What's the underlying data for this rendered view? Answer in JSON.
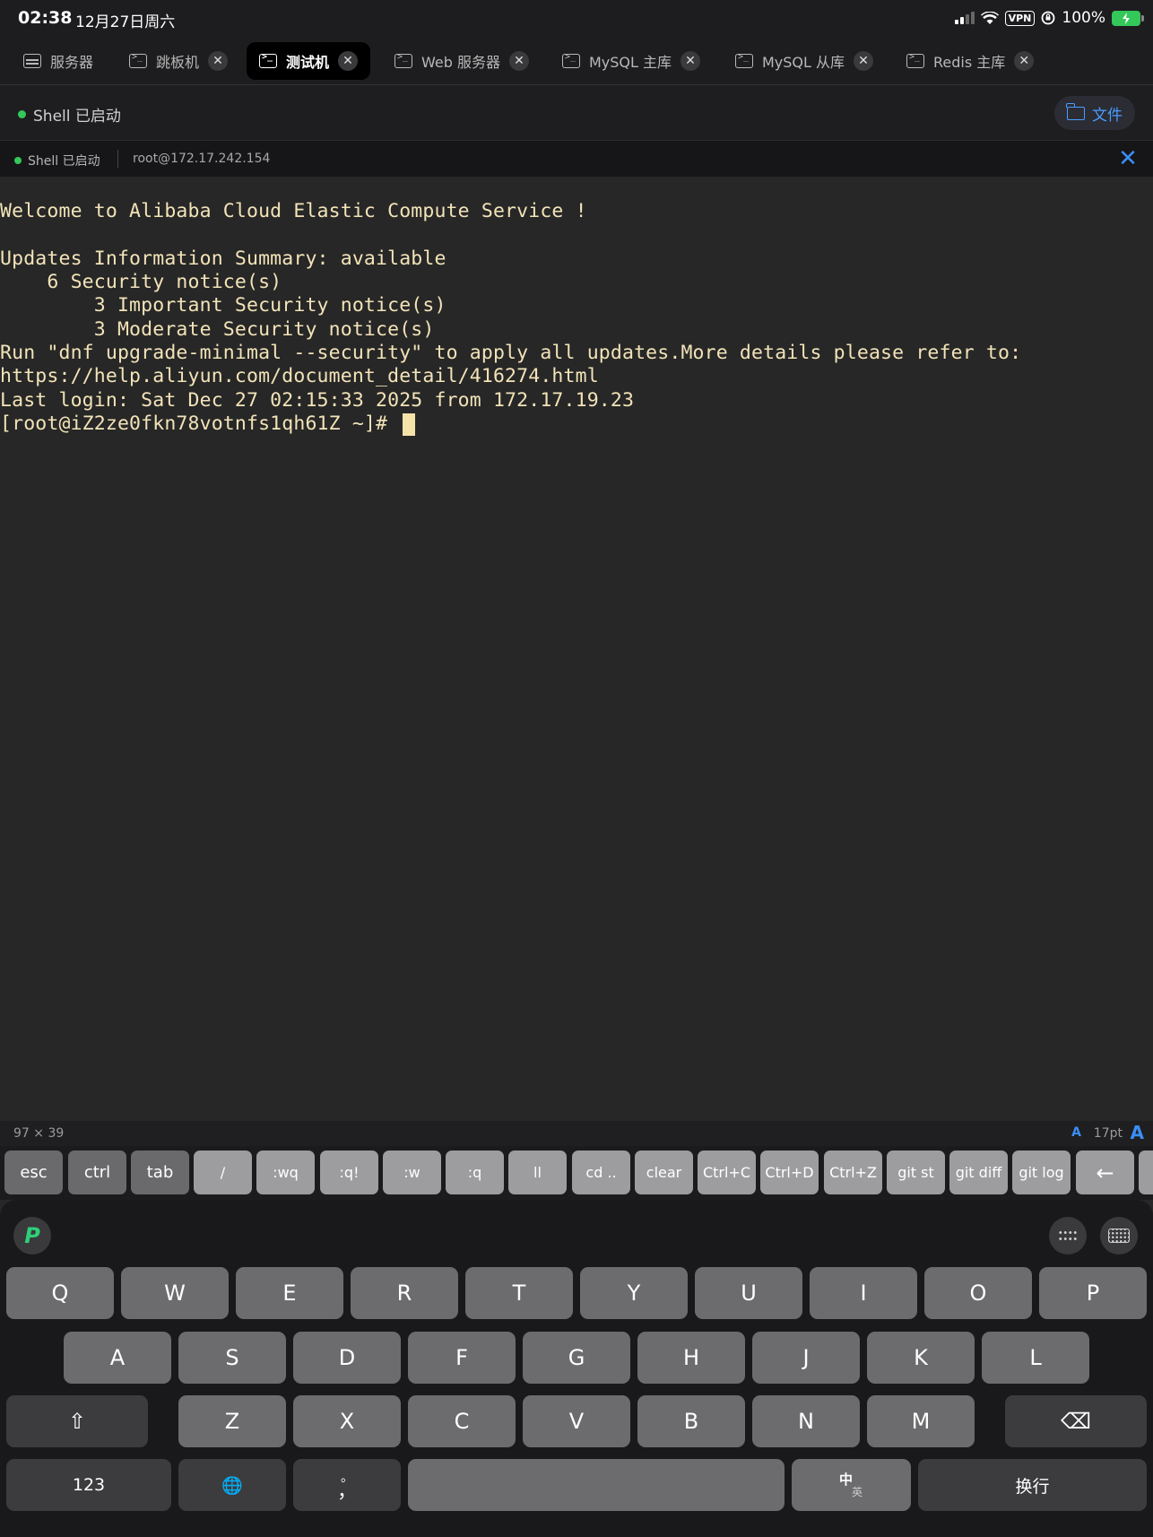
{
  "status_bar": {
    "time": "02:38",
    "date": "12月27日周六",
    "vpn": "VPN",
    "battery": "100%",
    "battery_color": "#34c759"
  },
  "tabs": [
    {
      "label": "服务器",
      "icon": "server-icon",
      "closable": false
    },
    {
      "label": "跳板机",
      "icon": "terminal-icon",
      "closable": true
    },
    {
      "label": "测试机",
      "icon": "terminal-icon",
      "closable": true,
      "active": true
    },
    {
      "label": "Web 服务器",
      "icon": "terminal-icon",
      "closable": true
    },
    {
      "label": "MySQL 主库",
      "icon": "terminal-icon",
      "closable": true
    },
    {
      "label": "MySQL 从库",
      "icon": "terminal-icon",
      "closable": true
    },
    {
      "label": "Redis 主库",
      "icon": "terminal-icon",
      "closable": true
    }
  ],
  "header": {
    "status": "Shell 已启动",
    "files_label": "文件",
    "accent": "#3b8ef5"
  },
  "session": {
    "status": "Shell 已启动",
    "host": "root@172.17.242.154"
  },
  "terminal": {
    "text_color": "#f2e3b8",
    "lines": [
      "Welcome to Alibaba Cloud Elastic Compute Service !",
      "",
      "Updates Information Summary: available",
      "    6 Security notice(s)",
      "        3 Important Security notice(s)",
      "        3 Moderate Security notice(s)",
      "Run \"dnf upgrade-minimal --security\" to apply all updates.More details please refer to:",
      "https://help.aliyun.com/document_detail/416274.html",
      "Last login: Sat Dec 27 02:15:33 2025 from 172.17.19.23",
      "[root@iZ2ze0fkn78votnfs1qh61Z ~]# "
    ]
  },
  "info_bar": {
    "size": "97 × 39",
    "font_small": "A",
    "font_size": "17pt",
    "font_large": "A"
  },
  "shortcuts": [
    "esc",
    "ctrl",
    "tab",
    "/",
    ":wq",
    ":q!",
    ":w",
    ":q",
    "ll",
    "cd ..",
    "clear",
    "Ctrl+C",
    "Ctrl+D",
    "Ctrl+Z",
    "git st",
    "git diff",
    "git log",
    "←"
  ],
  "keyboard": {
    "row1": [
      "Q",
      "W",
      "E",
      "R",
      "T",
      "Y",
      "U",
      "I",
      "O",
      "P"
    ],
    "row2": [
      "A",
      "S",
      "D",
      "F",
      "G",
      "H",
      "J",
      "K",
      "L"
    ],
    "row3": [
      "Z",
      "X",
      "C",
      "V",
      "B",
      "N",
      "M"
    ],
    "shift": "⇧",
    "delete": "⌫",
    "numbers": "123",
    "globe": "🌐",
    "punct_top": "。",
    "punct_bottom": "，",
    "lang_zh": "中",
    "lang_en": "英",
    "return": "换行"
  }
}
